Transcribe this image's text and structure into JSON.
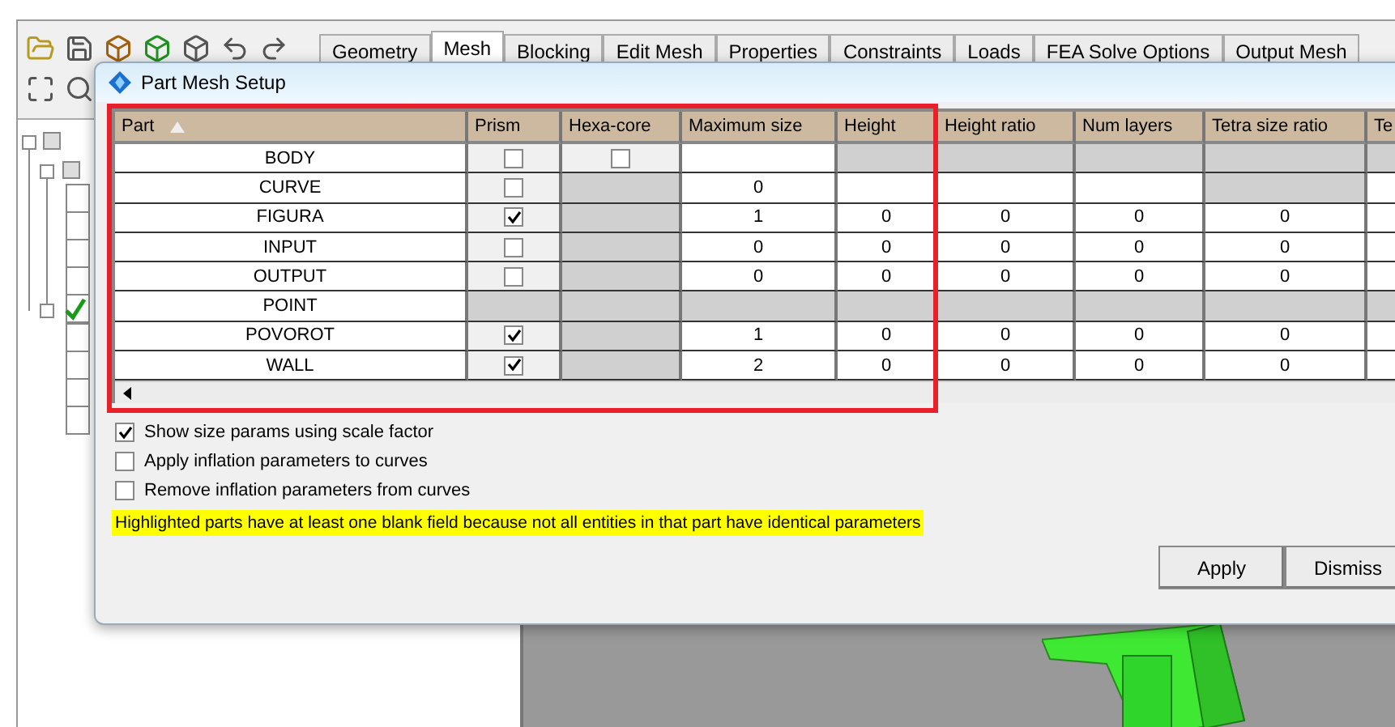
{
  "tabs": [
    {
      "label": "Geometry",
      "selected": false
    },
    {
      "label": "Mesh",
      "selected": true
    },
    {
      "label": "Blocking",
      "selected": false
    },
    {
      "label": "Edit Mesh",
      "selected": false
    },
    {
      "label": "Properties",
      "selected": false
    },
    {
      "label": "Constraints",
      "selected": false
    },
    {
      "label": "Loads",
      "selected": false
    },
    {
      "label": "FEA Solve Options",
      "selected": false
    },
    {
      "label": "Output Mesh",
      "selected": false
    }
  ],
  "dialog": {
    "title": "Part Mesh Setup",
    "table": {
      "columns": [
        "Part",
        "Prism",
        "Hexa-core",
        "Maximum size",
        "Height",
        "Height ratio",
        "Num layers",
        "Tetra size ratio",
        "Te"
      ],
      "rows": [
        {
          "cells": [
            {
              "kind": "name",
              "text": "BODY"
            },
            {
              "kind": "check",
              "checked": false
            },
            {
              "kind": "check",
              "checked": false
            },
            {
              "kind": "empty"
            },
            {
              "kind": "gray"
            },
            {
              "kind": "gray"
            },
            {
              "kind": "gray"
            },
            {
              "kind": "gray"
            },
            {
              "kind": "gray"
            }
          ]
        },
        {
          "cells": [
            {
              "kind": "name",
              "text": "CURVE"
            },
            {
              "kind": "check",
              "checked": false
            },
            {
              "kind": "gray"
            },
            {
              "kind": "value",
              "text": "0"
            },
            {
              "kind": "empty"
            },
            {
              "kind": "empty"
            },
            {
              "kind": "empty"
            },
            {
              "kind": "gray"
            },
            {
              "kind": "empty"
            }
          ]
        },
        {
          "cells": [
            {
              "kind": "name",
              "text": "FIGURA"
            },
            {
              "kind": "check",
              "checked": true
            },
            {
              "kind": "gray"
            },
            {
              "kind": "value",
              "text": "1"
            },
            {
              "kind": "value",
              "text": "0"
            },
            {
              "kind": "value",
              "text": "0"
            },
            {
              "kind": "value",
              "text": "0"
            },
            {
              "kind": "value",
              "text": "0"
            },
            {
              "kind": "empty"
            }
          ]
        },
        {
          "cells": [
            {
              "kind": "name",
              "text": "INPUT"
            },
            {
              "kind": "check",
              "checked": false
            },
            {
              "kind": "gray"
            },
            {
              "kind": "value",
              "text": "0"
            },
            {
              "kind": "value",
              "text": "0"
            },
            {
              "kind": "value",
              "text": "0"
            },
            {
              "kind": "value",
              "text": "0"
            },
            {
              "kind": "value",
              "text": "0"
            },
            {
              "kind": "empty"
            }
          ]
        },
        {
          "cells": [
            {
              "kind": "name",
              "text": "OUTPUT"
            },
            {
              "kind": "check",
              "checked": false
            },
            {
              "kind": "gray"
            },
            {
              "kind": "value",
              "text": "0"
            },
            {
              "kind": "value",
              "text": "0"
            },
            {
              "kind": "value",
              "text": "0"
            },
            {
              "kind": "value",
              "text": "0"
            },
            {
              "kind": "value",
              "text": "0"
            },
            {
              "kind": "empty"
            }
          ]
        },
        {
          "cells": [
            {
              "kind": "name",
              "text": "POINT"
            },
            {
              "kind": "gray"
            },
            {
              "kind": "gray"
            },
            {
              "kind": "gray"
            },
            {
              "kind": "gray"
            },
            {
              "kind": "gray"
            },
            {
              "kind": "gray"
            },
            {
              "kind": "gray"
            },
            {
              "kind": "gray"
            }
          ]
        },
        {
          "cells": [
            {
              "kind": "name",
              "text": "POVOROT"
            },
            {
              "kind": "check",
              "checked": true
            },
            {
              "kind": "gray"
            },
            {
              "kind": "value",
              "text": "1"
            },
            {
              "kind": "value",
              "text": "0"
            },
            {
              "kind": "value",
              "text": "0"
            },
            {
              "kind": "value",
              "text": "0"
            },
            {
              "kind": "value",
              "text": "0"
            },
            {
              "kind": "empty"
            }
          ]
        },
        {
          "cells": [
            {
              "kind": "name",
              "text": "WALL"
            },
            {
              "kind": "check",
              "checked": true
            },
            {
              "kind": "gray"
            },
            {
              "kind": "value",
              "text": "2"
            },
            {
              "kind": "value",
              "text": "0"
            },
            {
              "kind": "value",
              "text": "0"
            },
            {
              "kind": "value",
              "text": "0"
            },
            {
              "kind": "value",
              "text": "0"
            },
            {
              "kind": "empty"
            }
          ]
        }
      ]
    },
    "options": [
      {
        "label": "Show size params using scale factor",
        "checked": true
      },
      {
        "label": "Apply inflation parameters to curves",
        "checked": false
      },
      {
        "label": "Remove inflation parameters from curves",
        "checked": false
      }
    ],
    "note": "Highlighted parts have at least one blank field because not all entities in that part have identical parameters",
    "buttons": [
      "Apply",
      "Dismiss"
    ]
  }
}
